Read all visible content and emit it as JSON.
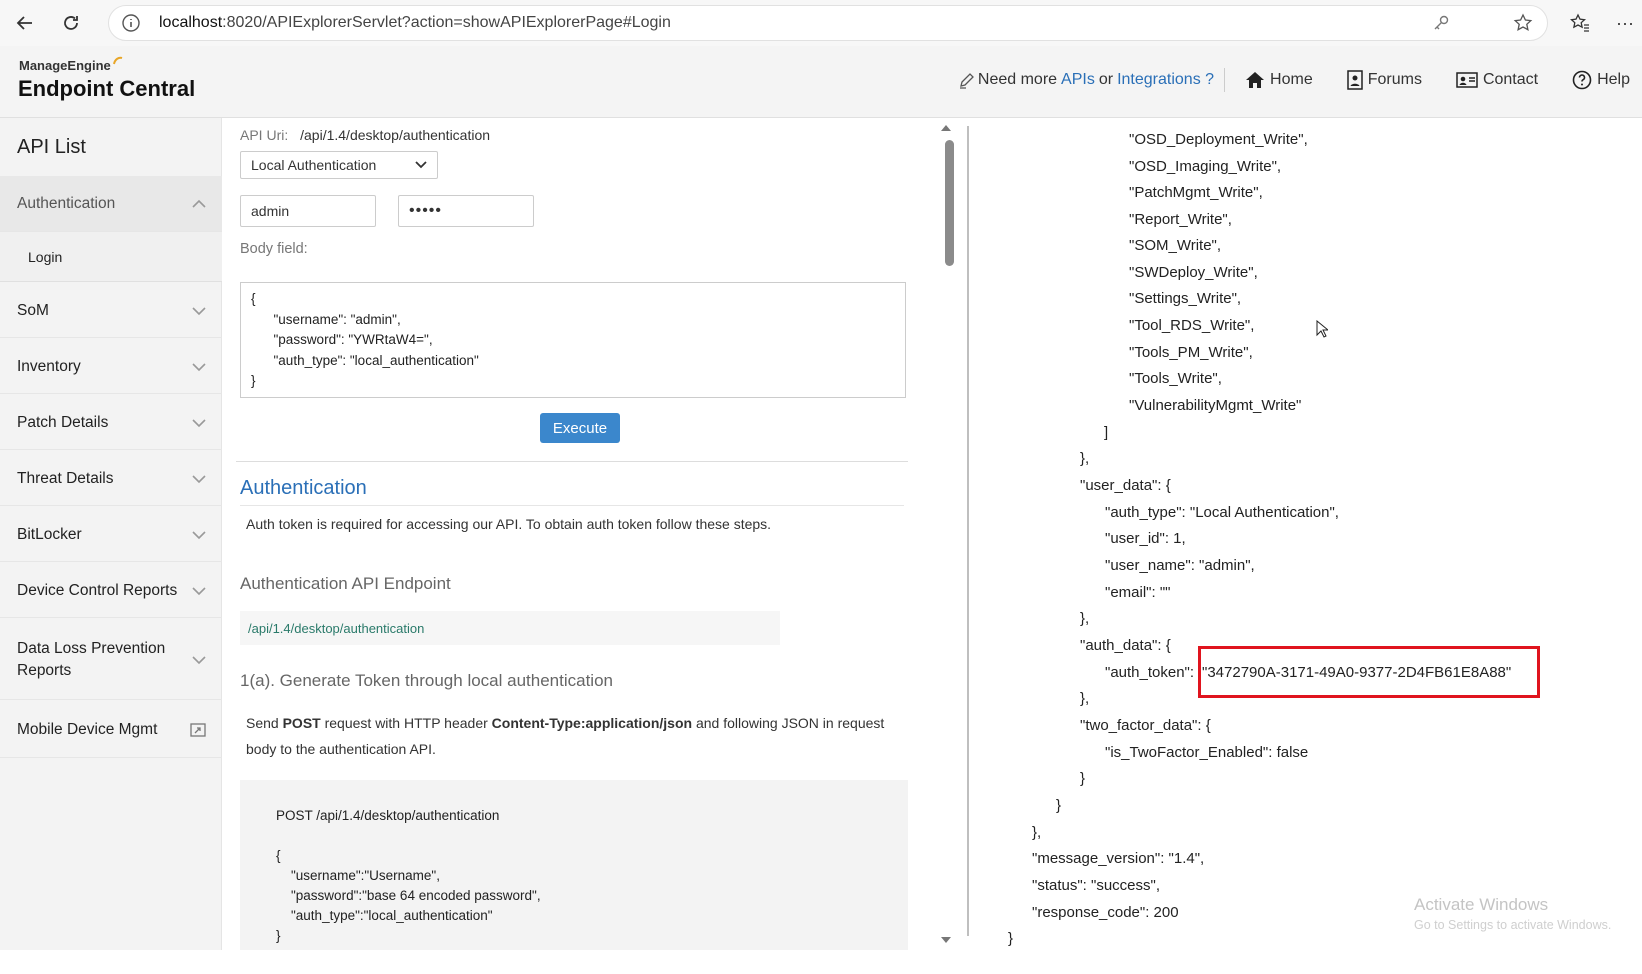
{
  "browser": {
    "url_host": "localhost",
    "url_rest": ":8020/APIExplorerServlet?action=showAPIExplorerPage#Login"
  },
  "header": {
    "logo_top": "ManageEngine",
    "logo_bottom": "Endpoint Central",
    "promo_prefix": "Need more",
    "promo_apis": "APIs",
    "promo_or": "or",
    "promo_integrations": "Integrations ?",
    "links": [
      "Home",
      "Forums",
      "Contact",
      "Help"
    ]
  },
  "sidebar": {
    "title": "API List",
    "items": [
      {
        "label": "Authentication"
      },
      {
        "label": "SoM"
      },
      {
        "label": "Inventory"
      },
      {
        "label": "Patch Details"
      },
      {
        "label": "Threat Details"
      },
      {
        "label": "BitLocker"
      },
      {
        "label": "Device Control Reports"
      },
      {
        "label": "Data Loss Prevention Reports"
      },
      {
        "label": "Mobile Device Mgmt"
      }
    ],
    "sub_item": "Login"
  },
  "form": {
    "api_uri_label": "API Uri:",
    "api_uri_value": "/api/1.4/desktop/authentication",
    "auth_select": "Local Authentication",
    "username_value": "admin",
    "password_mask": "•••••",
    "body_label": "Body field:",
    "body_lines": [
      "{",
      "      \"username\": \"admin\",",
      "      \"password\": \"YWRtaW4=\",",
      "      \"auth_type\": \"local_authentication\"",
      "}"
    ],
    "execute_label": "Execute"
  },
  "docs": {
    "section_title": "Authentication",
    "intro": "Auth token is required for accessing our API. To obtain auth token follow these steps.",
    "endpoint_heading": "Authentication API Endpoint",
    "endpoint_link": "/api/1.4/desktop/authentication",
    "step_heading": "1(a). Generate Token through local authentication",
    "step_text_1": "Send",
    "step_text_post": "POST",
    "step_text_2": "request with HTTP header",
    "step_text_header": "Content-Type:application/json",
    "step_text_3": "and following JSON in request",
    "step_text_4": "body to the authentication API.",
    "code_lines": [
      "POST /api/1.4/desktop/authentication",
      "",
      "{",
      "    \"username\":\"Username\",",
      "    \"password\":\"base 64 encoded password\",",
      "    \"auth_type\":\"local_authentication\"",
      "}"
    ]
  },
  "response": {
    "lines": [
      "\"OSD_Deployment_Write\",",
      "\"OSD_Imaging_Write\",",
      "\"PatchMgmt_Write\",",
      "\"Report_Write\",",
      "\"SOM_Write\",",
      "\"SWDeploy_Write\",",
      "\"Settings_Write\",",
      "\"Tool_RDS_Write\",",
      "\"Tools_PM_Write\",",
      "\"Tools_Write\",",
      "\"VulnerabilityMgmt_Write\"",
      "]",
      "},",
      "\"user_data\": {",
      "\"auth_type\": \"Local Authentication\",",
      "\"user_id\": 1,",
      "\"user_name\": \"admin\",",
      "\"email\": \"\"",
      "},",
      "\"auth_data\": {",
      "\"auth_token\":",
      "\"3472790A-3171-49A0-9377-2D4FB61E8A88\"",
      "},",
      "\"two_factor_data\": {",
      "\"is_TwoFactor_Enabled\": false",
      "}",
      "}",
      "},",
      "\"message_version\": \"1.4\",",
      "\"status\": \"success\",",
      "\"response_code\": 200",
      "}"
    ],
    "highlight_color": "#e0141e"
  },
  "watermark": {
    "line1": "Activate Windows",
    "line2": "Go to Settings to activate Windows."
  }
}
